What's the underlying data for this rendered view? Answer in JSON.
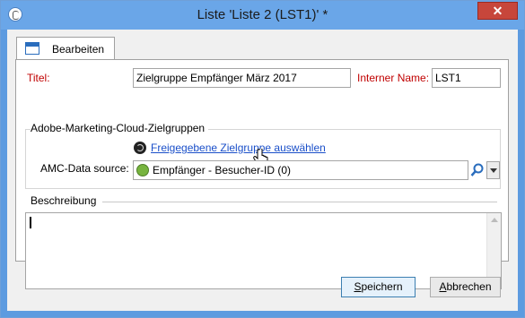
{
  "window": {
    "title": "Liste 'Liste 2 (LST1)' *",
    "close_glyph": "✕"
  },
  "tab": {
    "label": "Bearbeiten"
  },
  "form": {
    "titel_label": "Titel:",
    "titel_value": "Zielgruppe Empfänger März 2017",
    "interner_name_label": "Interner Name:",
    "interner_name_value": "LST1"
  },
  "amc_group": {
    "legend": "Adobe-Marketing-Cloud-Zielgruppen",
    "link_text": "Freigegebene Zielgruppe auswählen",
    "source_label": "AMC-Data source:",
    "source_value": "Empfänger - Besucher-ID (0)"
  },
  "description": {
    "legend": "Beschreibung",
    "value": ""
  },
  "buttons": {
    "save_label_accel": "S",
    "save_label_rest": "peichern",
    "cancel_label_accel": "A",
    "cancel_label_rest": "bbrechen"
  },
  "colors": {
    "titlebar": "#6aa6e8",
    "required_label": "#c00000",
    "link": "#1a4fc9",
    "close": "#c7463b"
  }
}
